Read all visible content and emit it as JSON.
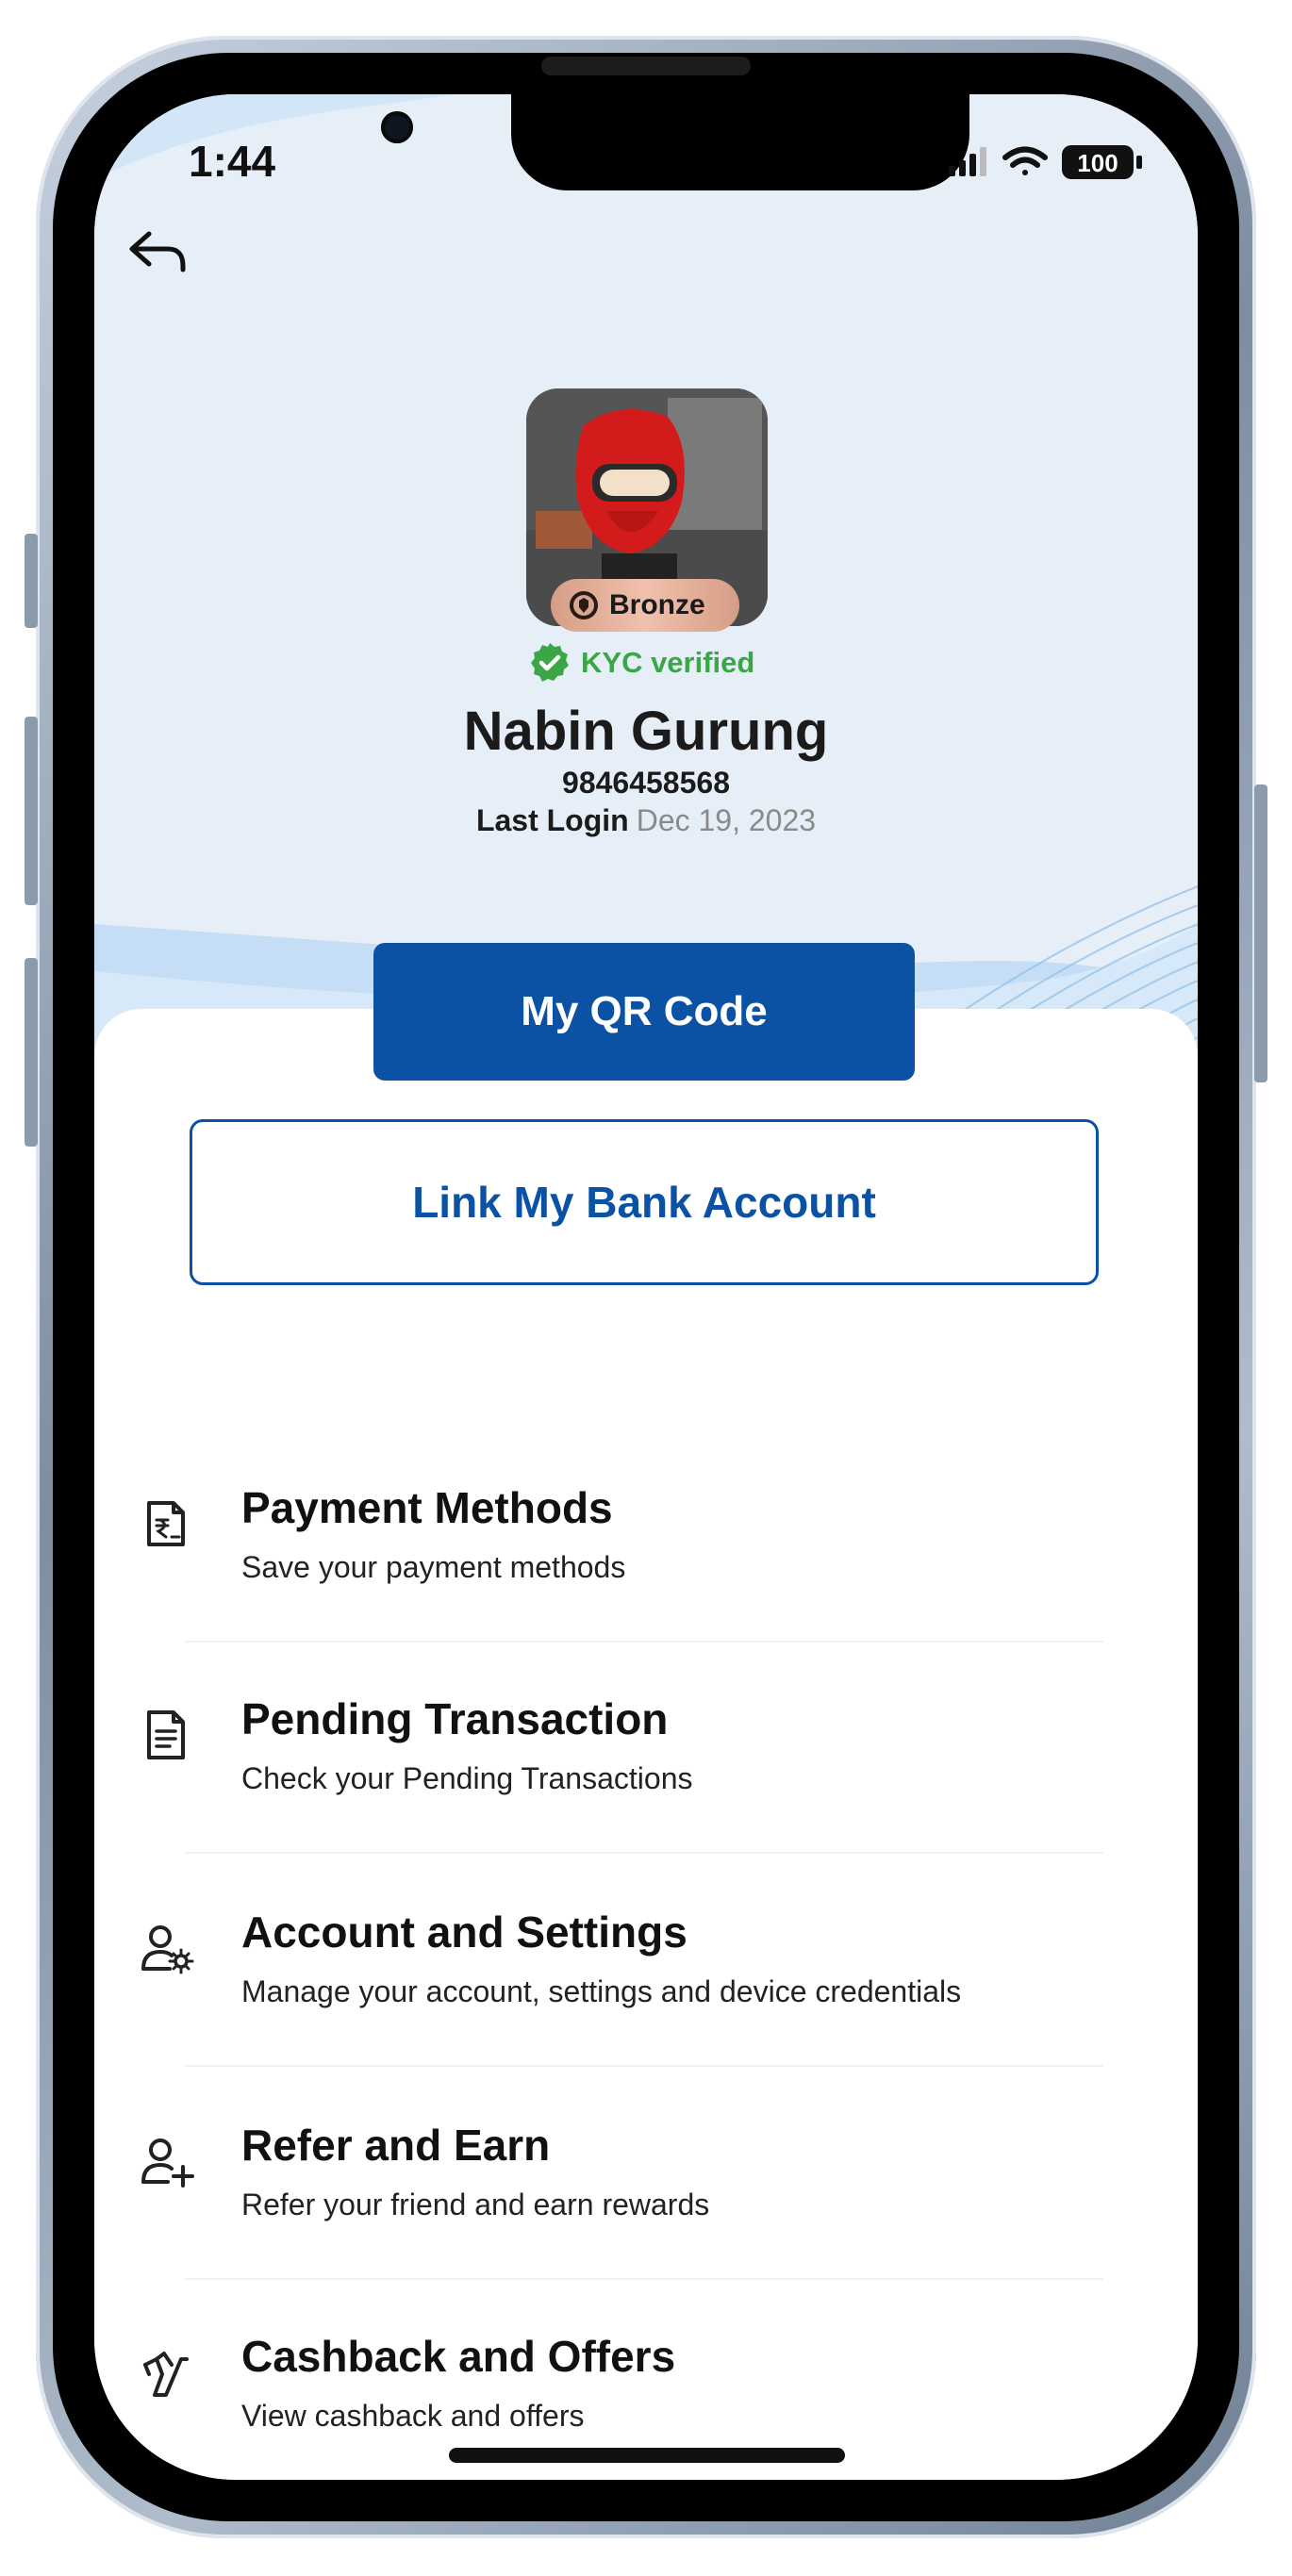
{
  "status_bar": {
    "time": "1:44",
    "battery": "100",
    "icons": [
      "signal-icon",
      "wifi-icon",
      "battery-icon"
    ]
  },
  "nav": {
    "back_icon": "back-arrow-icon"
  },
  "profile": {
    "tier_badge": "Bronze",
    "kyc_status": "KYC verified",
    "name": "Nabin Gurung",
    "phone": "9846458568",
    "last_login_label": "Last Login",
    "last_login_value": "Dec 19, 2023"
  },
  "buttons": {
    "qr_code": "My QR Code",
    "link_bank": "Link My Bank Account"
  },
  "menu": [
    {
      "title": "Payment Methods",
      "subtitle": "Save your payment methods",
      "icon": "payment-methods-icon"
    },
    {
      "title": "Pending Transaction",
      "subtitle": "Check your Pending Transactions",
      "icon": "document-icon"
    },
    {
      "title": "Account and Settings",
      "subtitle": "Manage your account, settings and device credentials",
      "icon": "user-settings-icon"
    },
    {
      "title": "Refer and Earn",
      "subtitle": "Refer your friend and earn rewards",
      "icon": "user-add-icon"
    },
    {
      "title": "Cashback and Offers",
      "subtitle": "View cashback and offers",
      "icon": "cashback-icon"
    }
  ],
  "colors": {
    "primary": "#0b52a4",
    "kyc_green": "#3aa645",
    "hero_bg": "#e6eff8",
    "badge_bronze": "#e2b09b"
  }
}
